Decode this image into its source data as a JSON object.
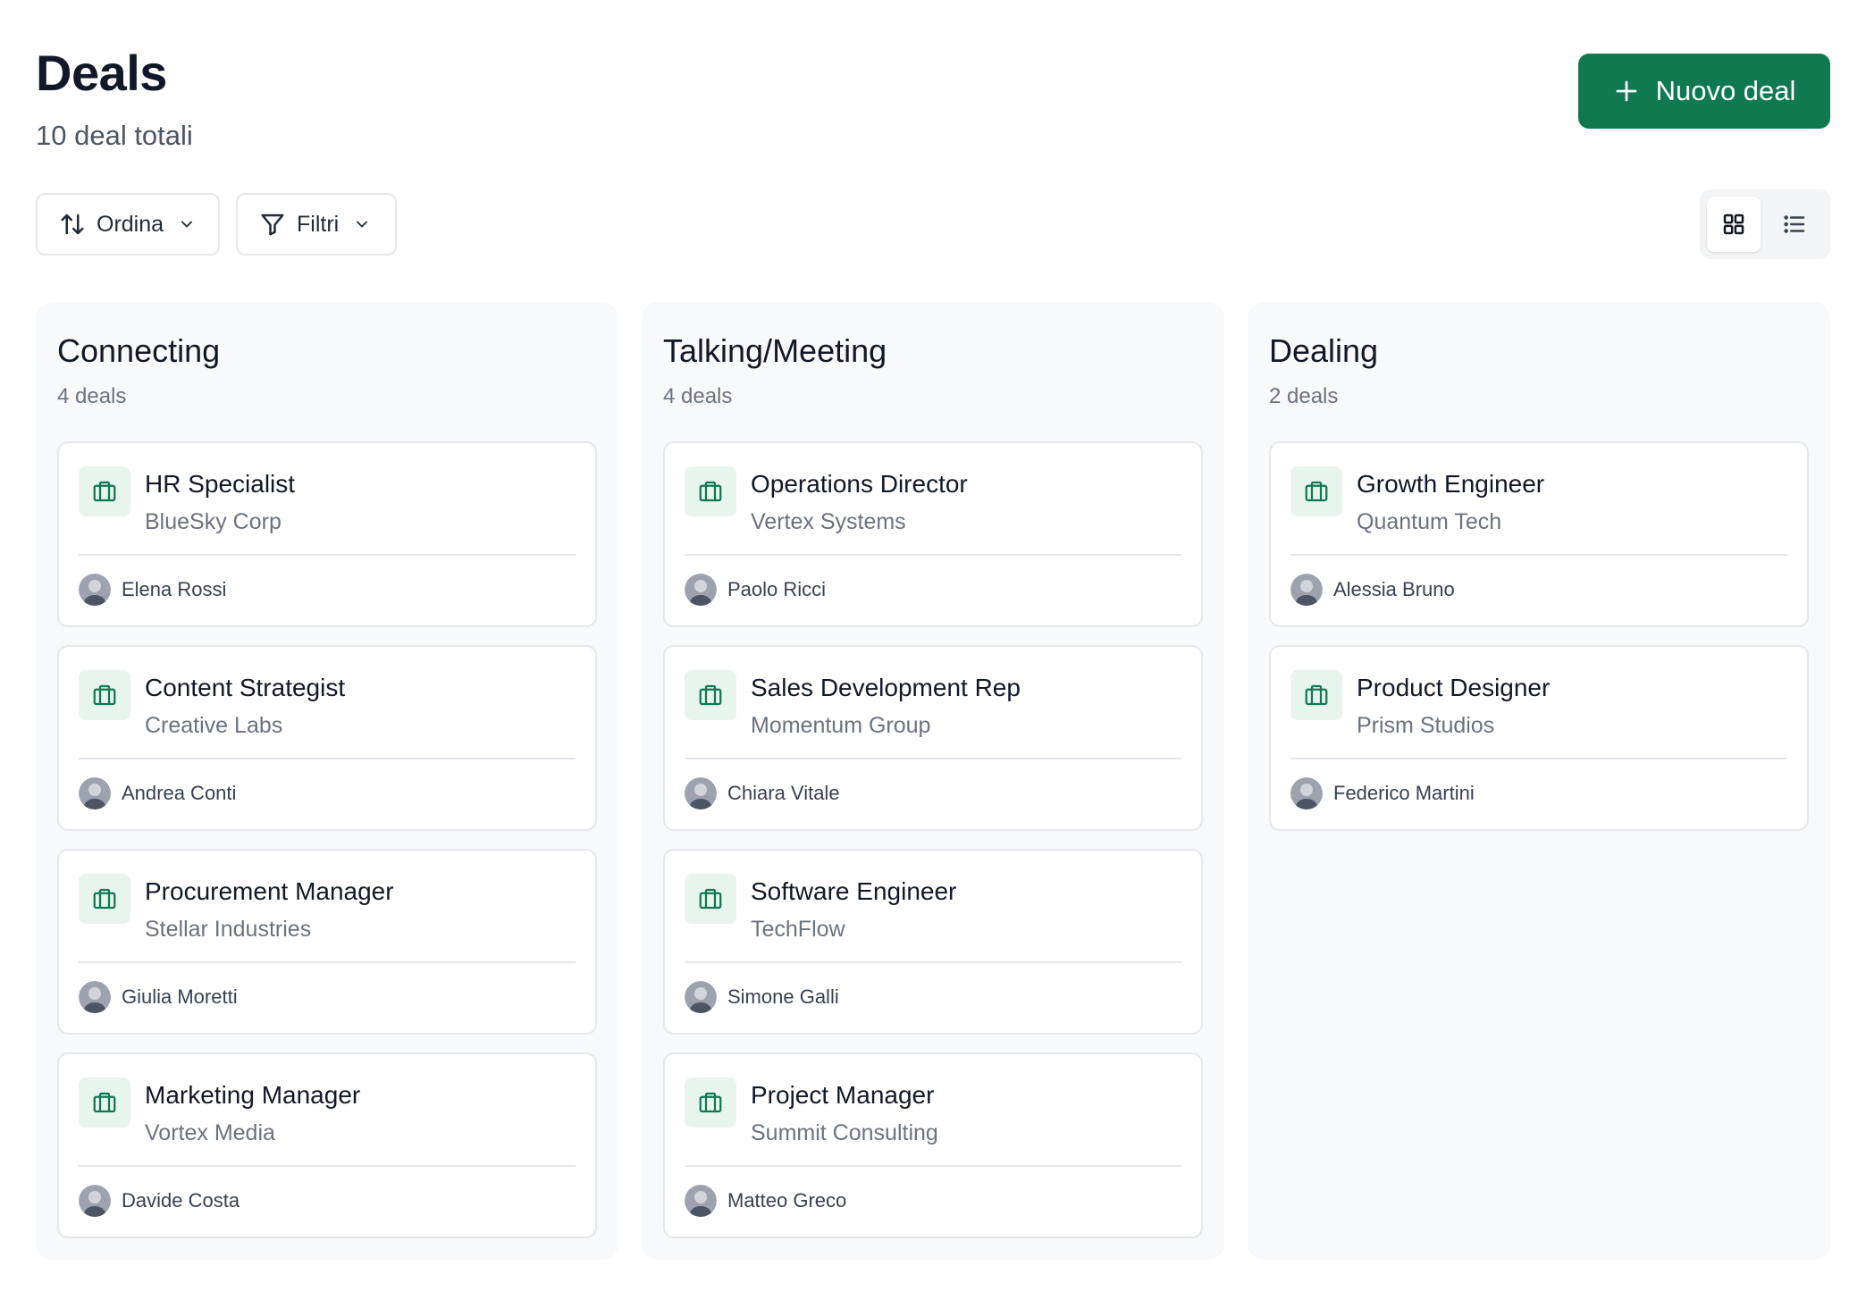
{
  "header": {
    "title": "Deals",
    "subtitle": "10 deal totali",
    "new_button_label": "Nuovo deal"
  },
  "toolbar": {
    "sort_label": "Ordina",
    "filter_label": "Filtri"
  },
  "colors": {
    "primary": "#0f7a4f",
    "icon_bg": "#e8f5ee",
    "column_bg": "#f8f9fa"
  },
  "columns": [
    {
      "title": "Connecting",
      "count": "4 deals",
      "cards": [
        {
          "title": "HR Specialist",
          "company": "BlueSky Corp",
          "owner": "Elena Rossi"
        },
        {
          "title": "Content Strategist",
          "company": "Creative Labs",
          "owner": "Andrea Conti"
        },
        {
          "title": "Procurement Manager",
          "company": "Stellar Industries",
          "owner": "Giulia Moretti"
        },
        {
          "title": "Marketing Manager",
          "company": "Vortex Media",
          "owner": "Davide Costa"
        }
      ]
    },
    {
      "title": "Talking/Meeting",
      "count": "4 deals",
      "cards": [
        {
          "title": "Operations Director",
          "company": "Vertex Systems",
          "owner": "Paolo Ricci"
        },
        {
          "title": "Sales Development Rep",
          "company": "Momentum Group",
          "owner": "Chiara Vitale"
        },
        {
          "title": "Software Engineer",
          "company": "TechFlow",
          "owner": "Simone Galli"
        },
        {
          "title": "Project Manager",
          "company": "Summit Consulting",
          "owner": "Matteo Greco"
        }
      ]
    },
    {
      "title": "Dealing",
      "count": "2 deals",
      "cards": [
        {
          "title": "Growth Engineer",
          "company": "Quantum Tech",
          "owner": "Alessia Bruno"
        },
        {
          "title": "Product Designer",
          "company": "Prism Studios",
          "owner": "Federico Martini"
        }
      ]
    }
  ]
}
